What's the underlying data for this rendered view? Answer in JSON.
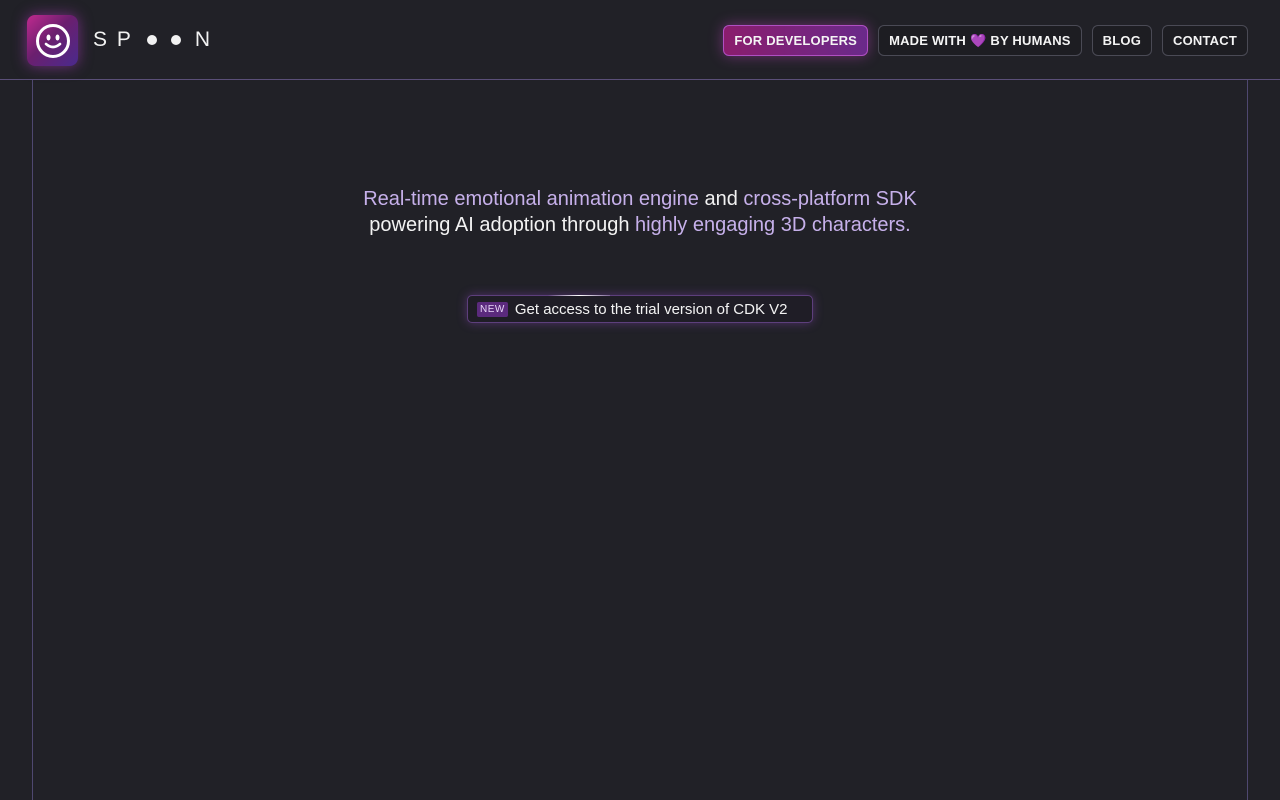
{
  "brand": {
    "logo_icon": "smiley-icon",
    "wordmark_start": "S P",
    "wordmark_end": "N"
  },
  "nav": {
    "for_developers": "FOR DEVELOPERS",
    "made_with_prefix": "MADE WITH",
    "heart_icon": "💜",
    "made_with_suffix": "BY HUMANS",
    "blog": "BLOG",
    "contact": "CONTACT"
  },
  "hero": {
    "part1": "Real-time emotional animation engine",
    "part2": " and ",
    "part3": "cross-platform SDK",
    "part4": " powering AI adoption through ",
    "part5": "highly engaging 3D characters."
  },
  "badge": {
    "tag": "NEW",
    "text": "Get access to the trial version of CDK V2"
  },
  "colors": {
    "background": "#212127",
    "accent": "#c6b0ea",
    "primary_button": "#8a1d6d",
    "frame_line": "#4f4870"
  }
}
